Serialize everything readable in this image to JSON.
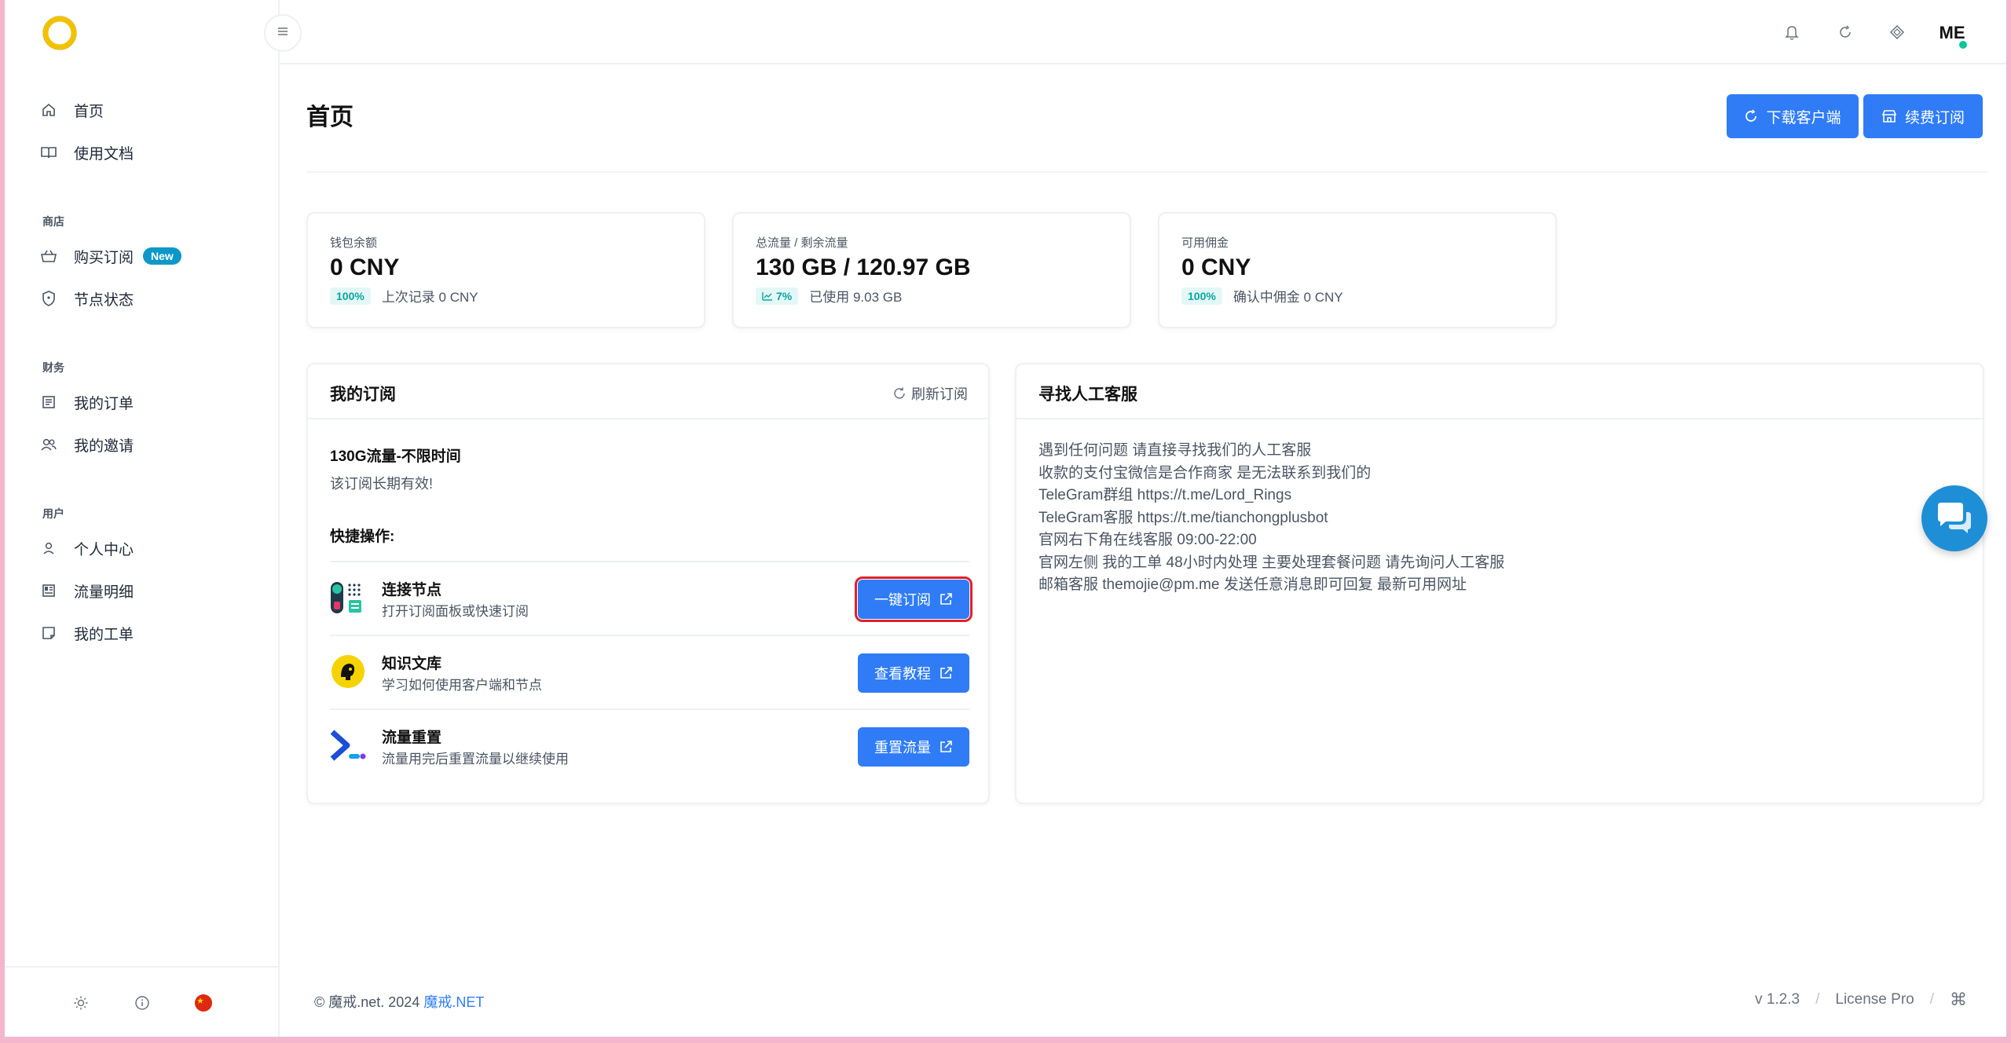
{
  "sidebar": {
    "items_main": [
      {
        "label": "首页",
        "icon": "home-icon"
      },
      {
        "label": "使用文档",
        "icon": "book-icon"
      }
    ],
    "group_shop": "商店",
    "items_shop": [
      {
        "label": "购买订阅",
        "icon": "basket-icon",
        "badge": "New"
      },
      {
        "label": "节点状态",
        "icon": "shield-icon"
      }
    ],
    "group_finance": "财务",
    "items_finance": [
      {
        "label": "我的订单",
        "icon": "order-list-icon"
      },
      {
        "label": "我的邀请",
        "icon": "users-icon"
      }
    ],
    "group_user": "用户",
    "items_user": [
      {
        "label": "个人中心",
        "icon": "user-icon"
      },
      {
        "label": "流量明细",
        "icon": "calendar-icon"
      },
      {
        "label": "我的工单",
        "icon": "ticket-icon"
      }
    ]
  },
  "header": {
    "avatar_initials": "ME"
  },
  "page": {
    "title": "首页",
    "download_btn": "下载客户端",
    "renew_btn": "续费订阅"
  },
  "stats": [
    {
      "label": "钱包余额",
      "value": "0 CNY",
      "pill": "100%",
      "sub": "上次记录 0 CNY"
    },
    {
      "label": "总流量 / 剩余流量",
      "value": "130 GB / 120.97 GB",
      "pill": "7%",
      "sub": "已使用 9.03 GB"
    },
    {
      "label": "可用佣金",
      "value": "0 CNY",
      "pill": "100%",
      "sub": "确认中佣金 0 CNY"
    }
  ],
  "subscription": {
    "title": "我的订阅",
    "refresh": "刷新订阅",
    "plan_name": "130G流量-不限时间",
    "plan_desc": "该订阅长期有效!",
    "quick_title": "快捷操作:",
    "actions": [
      {
        "title": "连接节点",
        "desc": "打开订阅面板或快速订阅",
        "button": "一键订阅"
      },
      {
        "title": "知识文库",
        "desc": "学习如何使用客户端和节点",
        "button": "查看教程"
      },
      {
        "title": "流量重置",
        "desc": "流量用完后重置流量以继续使用",
        "button": "重置流量"
      }
    ]
  },
  "support": {
    "title": "寻找人工客服",
    "lines": [
      "遇到任何问题 请直接寻找我们的人工客服",
      "收款的支付宝微信是合作商家 是无法联系到我们的",
      "TeleGram群组 https://t.me/Lord_Rings",
      "TeleGram客服 https://t.me/tianchongplusbot",
      "官网右下角在线客服 09:00-22:00",
      "官网左侧 我的工单 48小时内处理 主要处理套餐问题 请先询问人工客服",
      "邮箱客服 themojie@pm.me 发送任意消息即可回复 最新可用网址"
    ]
  },
  "footer": {
    "copyright": "© 魔戒.net. 2024",
    "brand_link": "魔戒.NET",
    "version": "v 1.2.3",
    "license": "License Pro",
    "cmd_symbol": "⌘"
  },
  "colors": {
    "primary": "#2f7cf6",
    "accent_teal": "#0ba5a0",
    "badge_new": "#0e98c9",
    "online_dot": "#10c59a"
  }
}
